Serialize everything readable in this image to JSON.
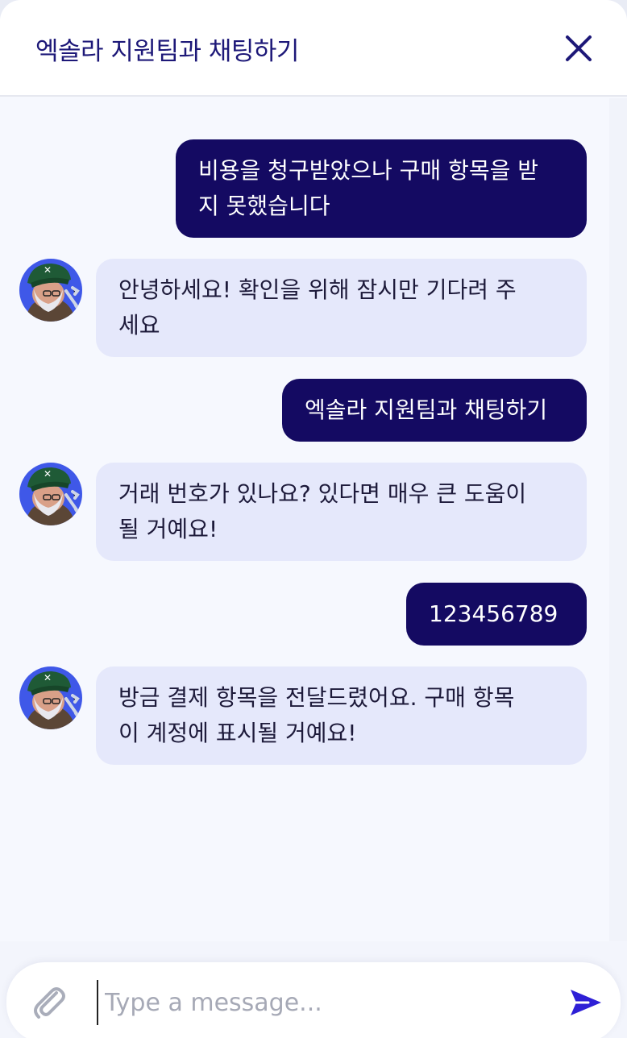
{
  "header": {
    "title": "엑솔라 지원팀과 채팅하기",
    "close_icon": "close-icon"
  },
  "messages": [
    {
      "sender": "user",
      "text_line1": "비용을 청구받았으나 구매 항목을 받",
      "text_line2": "지 못했습니다"
    },
    {
      "sender": "agent",
      "text_line1": "안녕하세요! 확인을 위해 잠시만 기다려 주",
      "text_line2": "세요"
    },
    {
      "sender": "user",
      "text_line1": "엑솔라 지원팀과 채팅하기"
    },
    {
      "sender": "agent",
      "text_line1": "거래 번호가 있나요? 있다면 매우 큰 도움이",
      "text_line2": "될 거예요!"
    },
    {
      "sender": "user",
      "text_line1": "123456789"
    },
    {
      "sender": "agent",
      "text_line1": "방금 결제 항목을 전달드렸어요. 구매 항목",
      "text_line2": "이 계정에 표시될 거예요!"
    }
  ],
  "agent_avatar": "support-agent-avatar",
  "composer": {
    "placeholder": "Type a message...",
    "attach_icon": "paperclip-icon",
    "send_icon": "send-icon"
  },
  "colors": {
    "user_bubble": "#140a62",
    "agent_bubble": "#e5e8fb",
    "title": "#1d1878",
    "send": "#2e1fd6"
  }
}
